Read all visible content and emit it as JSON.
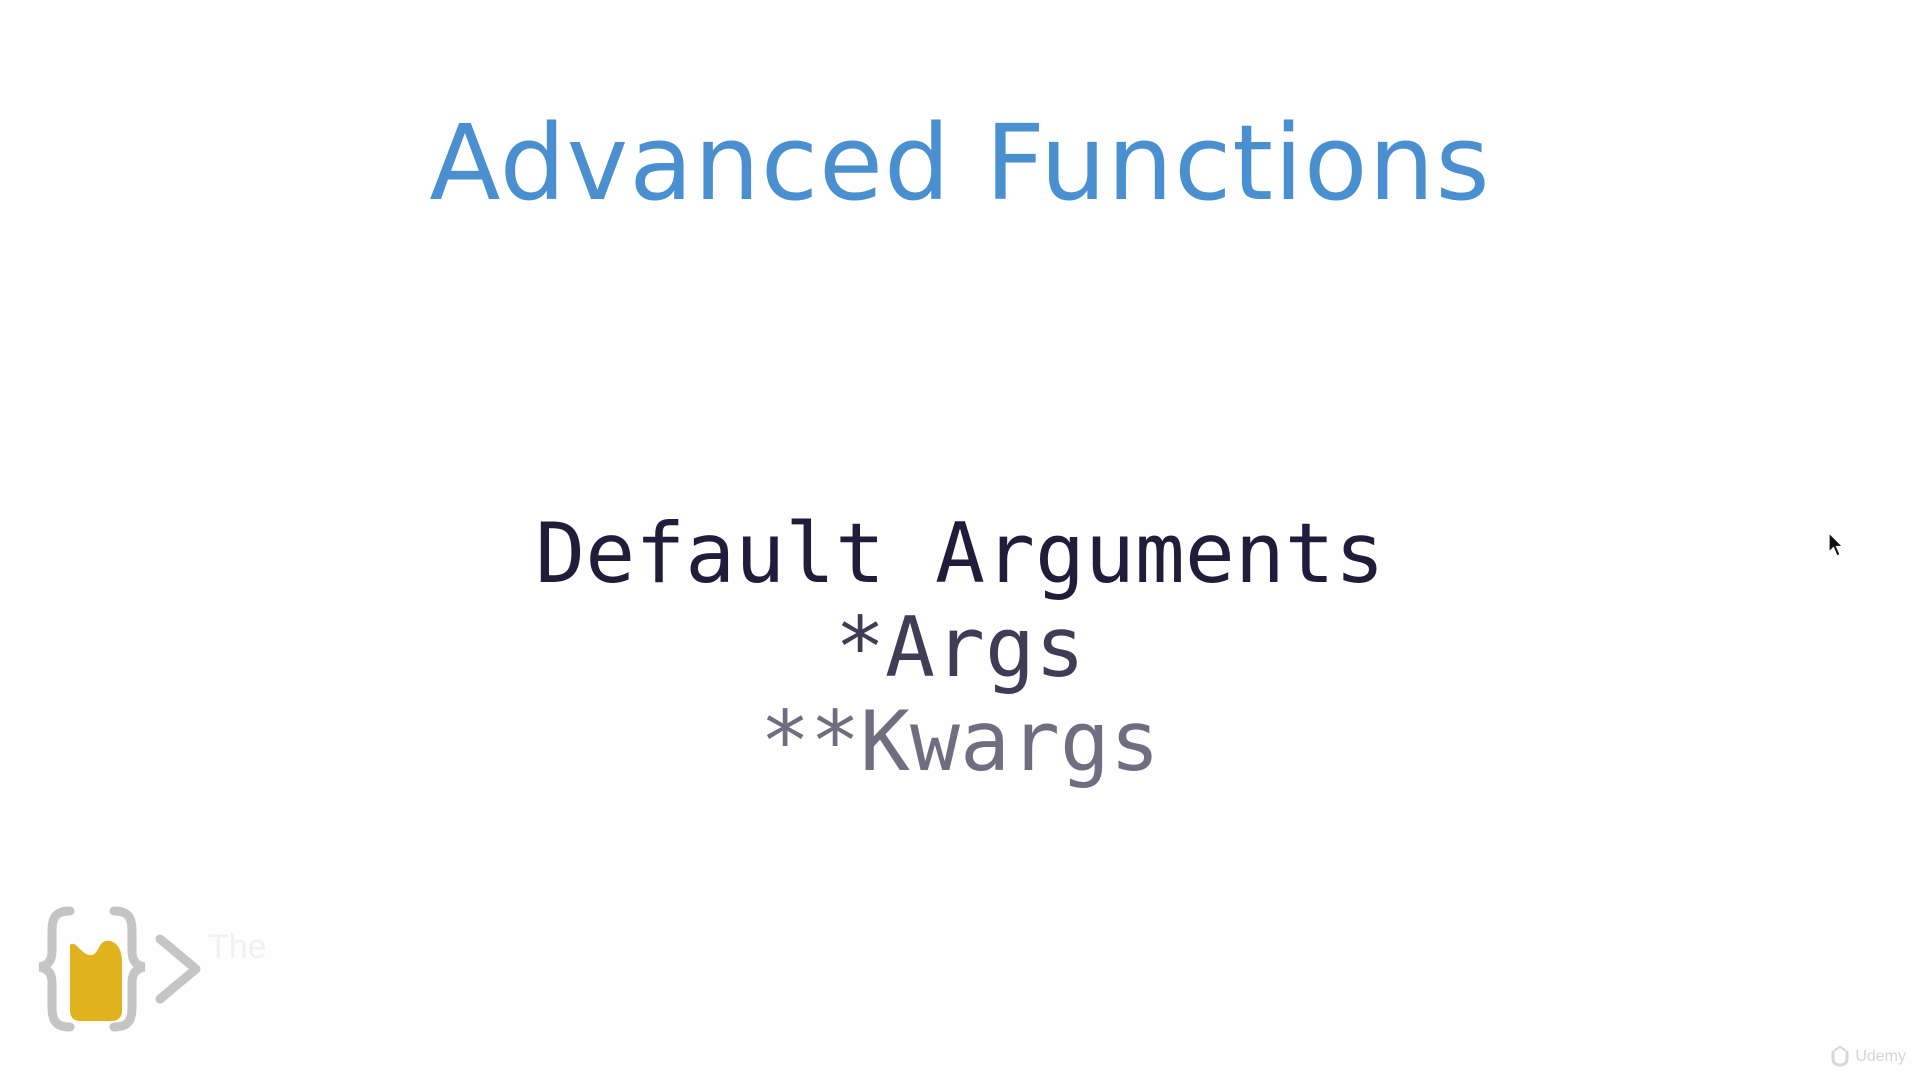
{
  "slide": {
    "title": "Advanced Functions",
    "topics": [
      {
        "text": "Default Arguments",
        "color": "#1f1d3a"
      },
      {
        "text": "*Args",
        "color": "#3f3d55"
      },
      {
        "text": "**Kwargs",
        "color": "#6f6d80"
      }
    ],
    "title_color": "#4a8fcf"
  },
  "logo": {
    "icon": "curly-braces-python-logo-icon",
    "brace_color": "#c4c4c4",
    "accent_color": "#e0b21e",
    "ghost_text": "The"
  },
  "watermark": {
    "icon": "udemy-logo-icon",
    "text": "Udemy"
  },
  "cursor": {
    "icon": "mouse-pointer-icon"
  }
}
